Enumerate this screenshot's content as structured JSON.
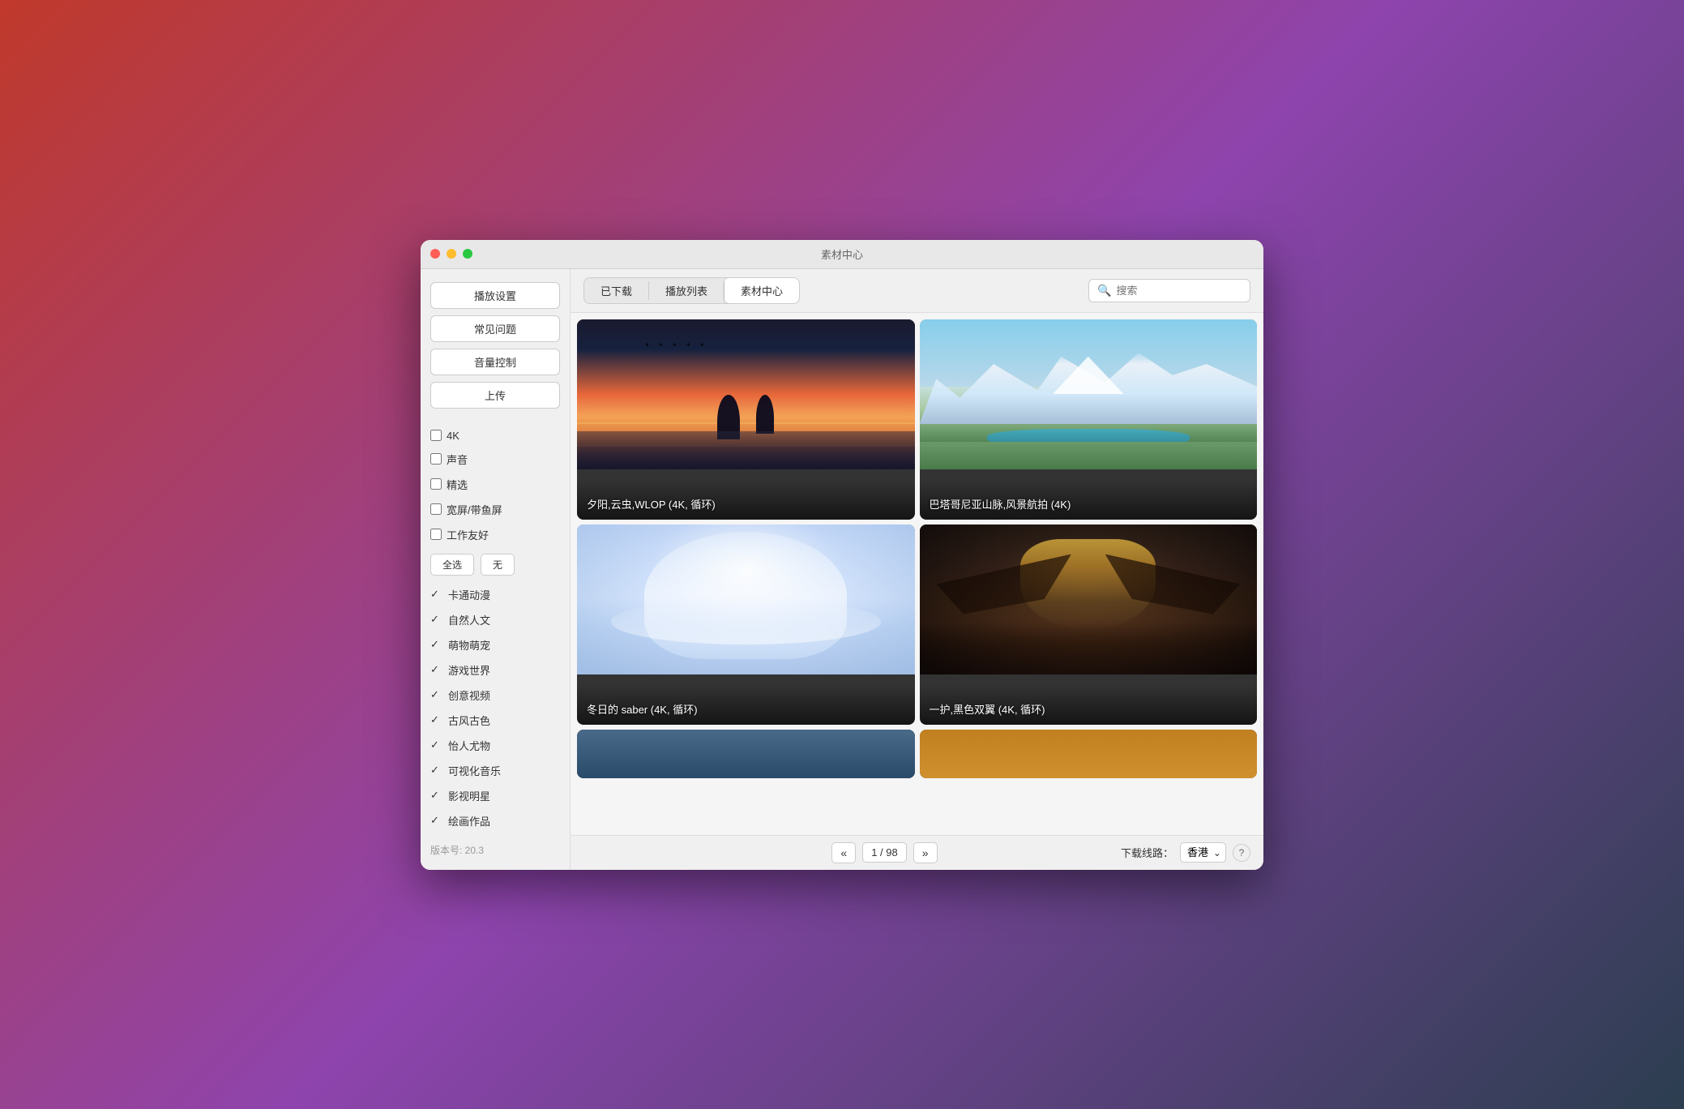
{
  "window": {
    "title": "素材中心"
  },
  "tabs": {
    "items": [
      {
        "label": "已下载",
        "active": false
      },
      {
        "label": "播放列表",
        "active": false
      },
      {
        "label": "素材中心",
        "active": true
      }
    ]
  },
  "search": {
    "placeholder": "搜索"
  },
  "sidebar": {
    "buttons": [
      {
        "label": "播放设置"
      },
      {
        "label": "常见问题"
      },
      {
        "label": "音量控制"
      },
      {
        "label": "上传"
      }
    ],
    "filters": [
      {
        "label": "4K",
        "checked": false
      },
      {
        "label": "声音",
        "checked": false
      },
      {
        "label": "精选",
        "checked": false
      },
      {
        "label": "宽屏/带鱼屏",
        "checked": false
      },
      {
        "label": "工作友好",
        "checked": false
      }
    ],
    "select_all": "全选",
    "select_none": "无",
    "categories": [
      {
        "label": "卡通动漫",
        "checked": true
      },
      {
        "label": "自然人文",
        "checked": true
      },
      {
        "label": "萌物萌宠",
        "checked": true
      },
      {
        "label": "游戏世界",
        "checked": true
      },
      {
        "label": "创意视频",
        "checked": true
      },
      {
        "label": "古风古色",
        "checked": true
      },
      {
        "label": "怡人尤物",
        "checked": true
      },
      {
        "label": "可视化音乐",
        "checked": true
      },
      {
        "label": "影视明星",
        "checked": true
      },
      {
        "label": "绘画作品",
        "checked": true
      }
    ],
    "version": "版本号: 20.3"
  },
  "grid": {
    "items": [
      {
        "title": "夕阳,云虫,WLOP (4K, 循环)",
        "scene": "sunset"
      },
      {
        "title": "巴塔哥尼亚山脉,风景航拍 (4K)",
        "scene": "mountain"
      },
      {
        "title": "冬日的 saber (4K, 循环)",
        "scene": "princess"
      },
      {
        "title": "一护,黑色双翼 (4K, 循环)",
        "scene": "darkwings"
      }
    ],
    "partial_items": [
      {
        "scene": "partial1"
      },
      {
        "scene": "partial2"
      }
    ]
  },
  "pagination": {
    "prev": "«",
    "next": "»",
    "current": "1",
    "total": "98",
    "display": "1 / 98"
  },
  "download": {
    "label": "下载线路：",
    "location": "香港",
    "help": "?"
  }
}
